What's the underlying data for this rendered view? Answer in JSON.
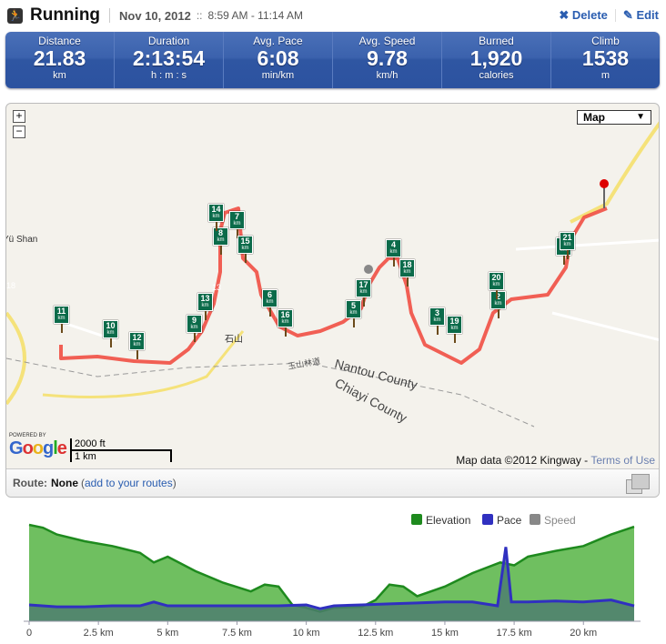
{
  "header": {
    "activity": "Running",
    "icon": "runner-icon",
    "date": "Nov 10, 2012",
    "separator": "::",
    "time_range": "8:59 AM - 11:14 AM",
    "delete_label": "Delete",
    "edit_label": "Edit"
  },
  "stats": [
    {
      "label": "Distance",
      "value": "21.83",
      "unit": "km"
    },
    {
      "label": "Duration",
      "value": "2:13:54",
      "unit": "h : m : s"
    },
    {
      "label": "Avg. Pace",
      "value": "6:08",
      "unit": "min/km"
    },
    {
      "label": "Avg. Speed",
      "value": "9.78",
      "unit": "km/h"
    },
    {
      "label": "Burned",
      "value": "1,920",
      "unit": "calories"
    },
    {
      "label": "Climb",
      "value": "1538",
      "unit": "m"
    }
  ],
  "map": {
    "zoom_in": "+",
    "zoom_out": "−",
    "map_type": "Map",
    "km_markers": [
      "1",
      "2",
      "3",
      "4",
      "5",
      "6",
      "7",
      "8",
      "9",
      "10",
      "11",
      "12",
      "13",
      "14",
      "15",
      "16",
      "17",
      "18",
      "19",
      "20",
      "21"
    ],
    "marker_unit": "km",
    "labels": {
      "county1": "Nantou County",
      "county2": "Chiayi County",
      "place1": "Yü Shan",
      "place2": "石山",
      "road": "玉山林道",
      "shield1": "18",
      "shield2": "13"
    },
    "powered_by": "POWERED BY",
    "google": "Google",
    "scale_ft": "2000 ft",
    "scale_km": "1 km",
    "attribution": "Map data ©2012 Kingway -",
    "terms": "Terms of Use",
    "route_color": "#f0453a"
  },
  "route_bar": {
    "label": "Route:",
    "value": "None",
    "link": "add to your routes"
  },
  "chart_data": {
    "type": "area",
    "legend": [
      "Elevation",
      "Pace",
      "Speed"
    ],
    "legend_placement": "top-right",
    "colors": {
      "Elevation": "#1e8a1e",
      "Pace": "#3030c0",
      "Speed": "#888888"
    },
    "x_ticks": [
      "0",
      "2.5 km",
      "5 km",
      "7.5 km",
      "10 km",
      "12.5 km",
      "15 km",
      "17.5 km",
      "20 km"
    ],
    "xlim": [
      0,
      21.83
    ],
    "grid": false,
    "series": [
      {
        "name": "Elevation",
        "x": [
          0,
          0.5,
          1,
          2,
          3,
          4,
          4.5,
          5,
          6,
          7,
          8,
          8.5,
          9,
          9.5,
          10,
          10.5,
          11,
          12,
          12.5,
          13,
          13.5,
          14,
          15,
          16,
          17,
          17.5,
          18,
          19,
          20,
          21,
          21.83
        ],
        "values": [
          100,
          97,
          90,
          83,
          78,
          71,
          61,
          67,
          52,
          40,
          31,
          38,
          36,
          17,
          14,
          10,
          14,
          15,
          22,
          38,
          36,
          26,
          36,
          50,
          61,
          58,
          67,
          73,
          78,
          90,
          98
        ]
      },
      {
        "name": "Pace",
        "x": [
          0,
          1,
          2,
          3,
          4,
          4.5,
          5,
          6,
          7,
          8,
          9,
          10,
          10.5,
          11,
          12,
          13,
          14,
          15,
          16,
          16.9,
          17.2,
          17.4,
          18,
          19,
          20,
          21,
          21.83
        ],
        "values": [
          17,
          15,
          15,
          16,
          16,
          20,
          16,
          16,
          16,
          16,
          16,
          17,
          13,
          16,
          17,
          18,
          19,
          20,
          20,
          16,
          77,
          20,
          20,
          21,
          20,
          22,
          16
        ]
      }
    ]
  }
}
